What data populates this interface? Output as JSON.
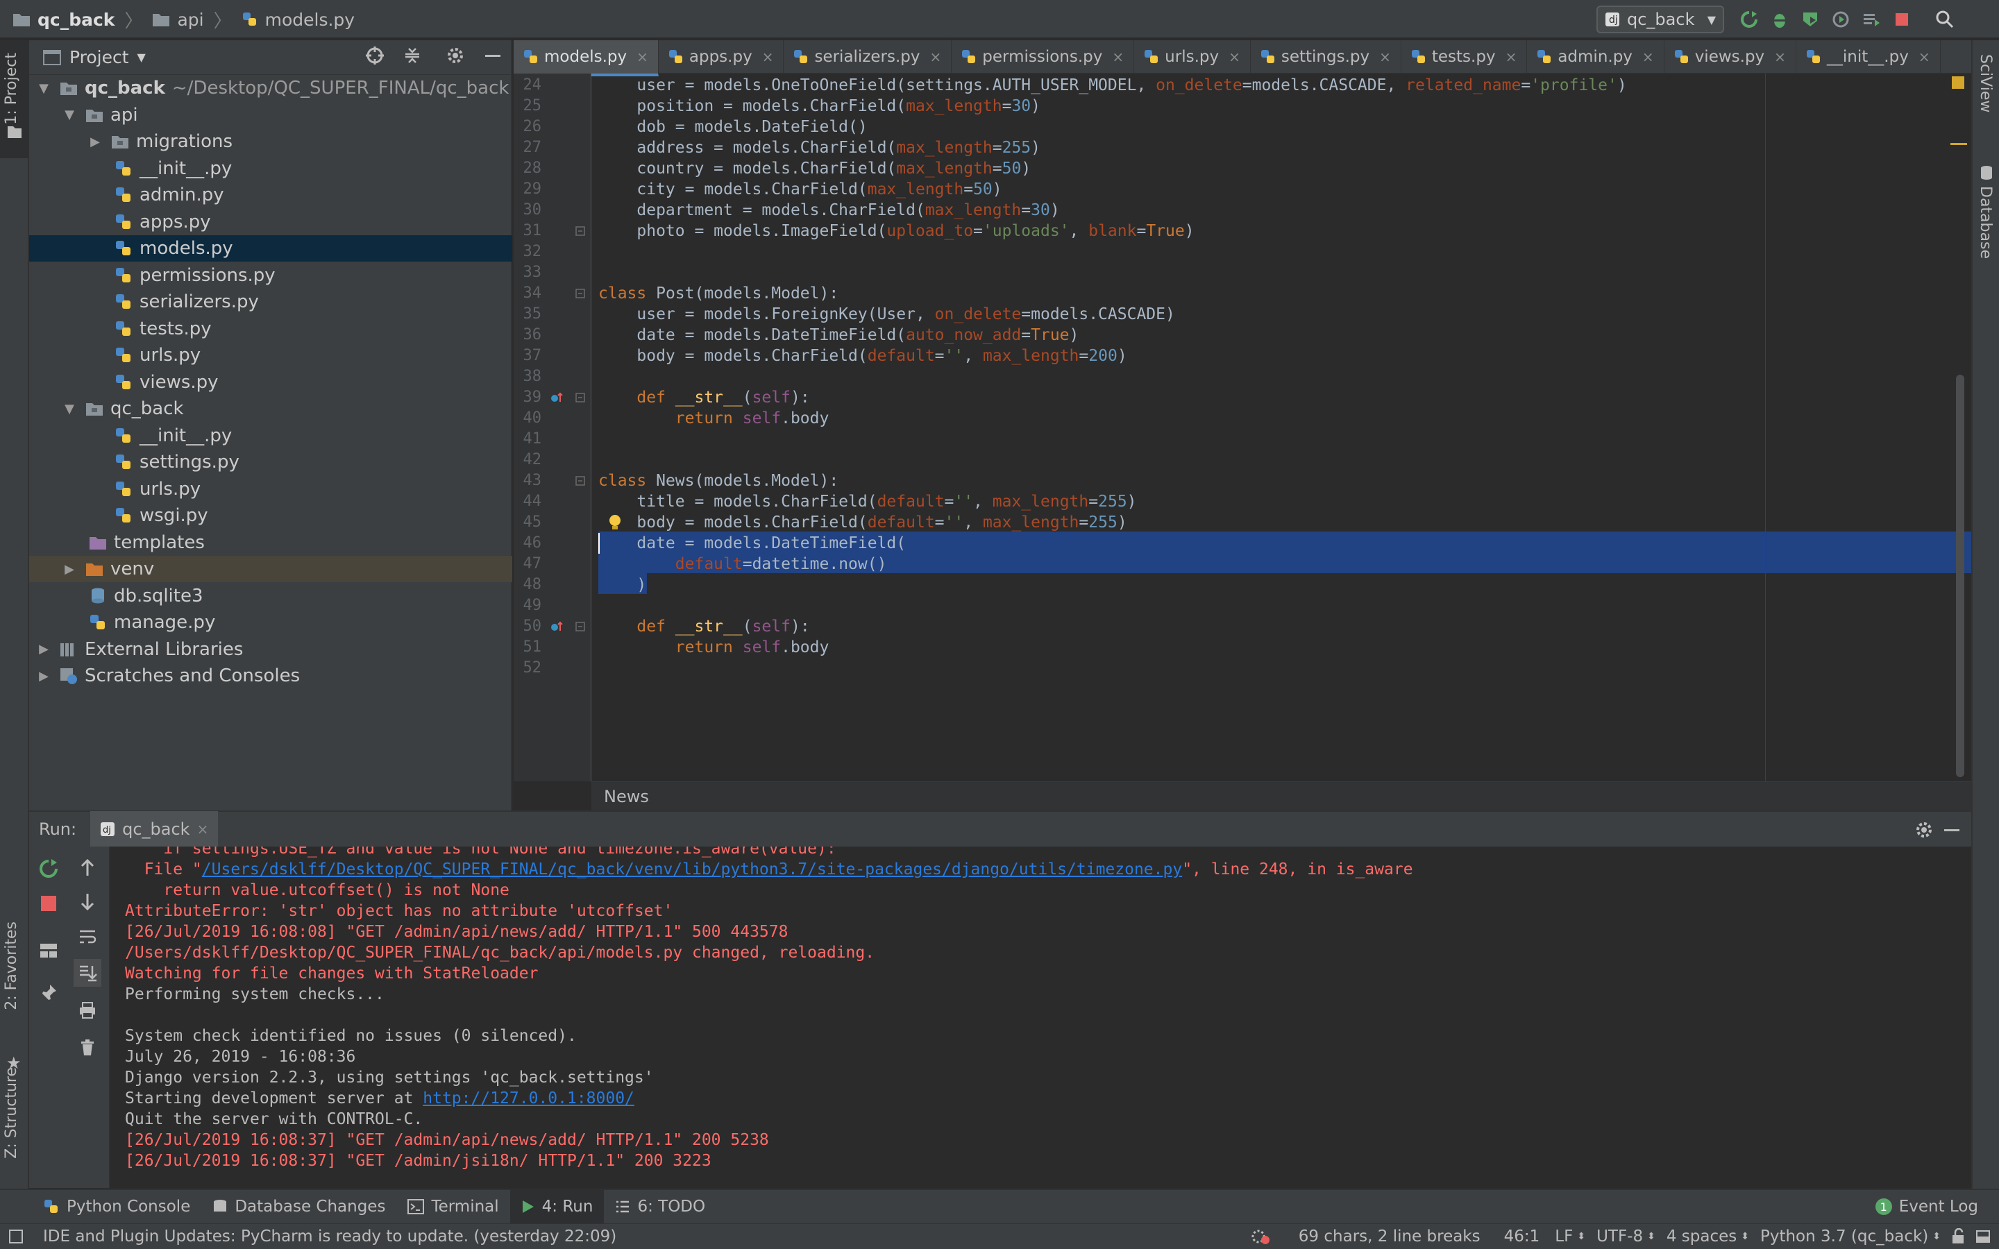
{
  "breadcrumb": [
    "qc_back",
    "api",
    "models.py"
  ],
  "run_config": {
    "name": "qc_back"
  },
  "side_labels": {
    "project": "1: Project",
    "favorites": "2: Favorites",
    "structure": "Z: Structure",
    "sciview": "SciView",
    "database": "Database"
  },
  "project_panel": {
    "title": "Project",
    "tree": [
      {
        "label": "qc_back",
        "path": "~/Desktop/QC_SUPER_FINAL/qc_back",
        "icon": "folder-icon",
        "arrow": "▼",
        "level": 0,
        "bold": true
      },
      {
        "label": "api",
        "icon": "folder-icon",
        "arrow": "▼",
        "level": 1
      },
      {
        "label": "migrations",
        "icon": "folder-icon",
        "arrow": "▶",
        "level": 2
      },
      {
        "label": "__init__.py",
        "icon": "python-file-icon",
        "level": 3
      },
      {
        "label": "admin.py",
        "icon": "python-file-icon",
        "level": 3
      },
      {
        "label": "apps.py",
        "icon": "python-file-icon",
        "level": 3
      },
      {
        "label": "models.py",
        "icon": "python-file-icon",
        "level": 3,
        "selected": true
      },
      {
        "label": "permissions.py",
        "icon": "python-file-icon",
        "level": 3
      },
      {
        "label": "serializers.py",
        "icon": "python-file-icon",
        "level": 3
      },
      {
        "label": "tests.py",
        "icon": "python-file-icon",
        "level": 3
      },
      {
        "label": "urls.py",
        "icon": "python-file-icon",
        "level": 3
      },
      {
        "label": "views.py",
        "icon": "python-file-icon",
        "level": 3
      },
      {
        "label": "qc_back",
        "icon": "folder-icon",
        "arrow": "▼",
        "level": 1
      },
      {
        "label": "__init__.py",
        "icon": "python-file-icon",
        "level": 3
      },
      {
        "label": "settings.py",
        "icon": "python-file-icon",
        "level": 3
      },
      {
        "label": "urls.py",
        "icon": "python-file-icon",
        "level": 3
      },
      {
        "label": "wsgi.py",
        "icon": "python-file-icon",
        "level": 3
      },
      {
        "label": "templates",
        "icon": "folder-purple-icon",
        "level": 2
      },
      {
        "label": "venv",
        "icon": "folder-orange-icon",
        "arrow": "▶",
        "level": 1,
        "venv": true
      },
      {
        "label": "db.sqlite3",
        "icon": "database-icon",
        "level": 2
      },
      {
        "label": "manage.py",
        "icon": "python-file-icon",
        "level": 2
      },
      {
        "label": "External Libraries",
        "icon": "library-icon",
        "arrow": "▶",
        "level": 0
      },
      {
        "label": "Scratches and Consoles",
        "icon": "scratch-icon",
        "arrow": "▶",
        "level": 0
      }
    ]
  },
  "tabs": [
    {
      "label": "models.py",
      "active": true
    },
    {
      "label": "apps.py"
    },
    {
      "label": "serializers.py"
    },
    {
      "label": "permissions.py"
    },
    {
      "label": "urls.py"
    },
    {
      "label": "settings.py"
    },
    {
      "label": "tests.py"
    },
    {
      "label": "admin.py"
    },
    {
      "label": "views.py"
    },
    {
      "label": "__init__.py"
    }
  ],
  "editor": {
    "lines": [
      {
        "n": "24",
        "code": [
          [
            "    user = models.OneToOneField(settings.AUTH_USER_MODEL, ",
            ""
          ],
          [
            "on_delete",
            "param"
          ],
          [
            "=models.CASCADE, ",
            ""
          ],
          [
            "related_name",
            "param"
          ],
          [
            "=",
            ""
          ],
          [
            "'profile'",
            "str"
          ],
          [
            ")",
            ""
          ]
        ]
      },
      {
        "n": "25",
        "code": [
          [
            "    position = models.CharField(",
            ""
          ],
          [
            "max_length",
            "param"
          ],
          [
            "=",
            ""
          ],
          [
            "30",
            "num"
          ],
          [
            ")",
            ""
          ]
        ]
      },
      {
        "n": "26",
        "code": [
          [
            "    dob = models.DateField()",
            ""
          ]
        ]
      },
      {
        "n": "27",
        "code": [
          [
            "    address = models.CharField(",
            ""
          ],
          [
            "max_length",
            "param"
          ],
          [
            "=",
            ""
          ],
          [
            "255",
            "num"
          ],
          [
            ")",
            ""
          ]
        ]
      },
      {
        "n": "28",
        "code": [
          [
            "    country = models.CharField(",
            ""
          ],
          [
            "max_length",
            "param"
          ],
          [
            "=",
            ""
          ],
          [
            "50",
            "num"
          ],
          [
            ")",
            ""
          ]
        ]
      },
      {
        "n": "29",
        "code": [
          [
            "    city = models.CharField(",
            ""
          ],
          [
            "max_length",
            "param"
          ],
          [
            "=",
            ""
          ],
          [
            "50",
            "num"
          ],
          [
            ")",
            ""
          ]
        ]
      },
      {
        "n": "30",
        "code": [
          [
            "    department = models.CharField(",
            ""
          ],
          [
            "max_length",
            "param"
          ],
          [
            "=",
            ""
          ],
          [
            "30",
            "num"
          ],
          [
            ")",
            ""
          ]
        ]
      },
      {
        "n": "31",
        "code": [
          [
            "    photo = models.ImageField(",
            ""
          ],
          [
            "upload_to",
            "param"
          ],
          [
            "=",
            ""
          ],
          [
            "'uploads'",
            "str"
          ],
          [
            ", ",
            ""
          ],
          [
            "blank",
            "param"
          ],
          [
            "=",
            ""
          ],
          [
            "True",
            "kw"
          ],
          [
            ")",
            ""
          ]
        ]
      },
      {
        "n": "32",
        "code": []
      },
      {
        "n": "33",
        "code": []
      },
      {
        "n": "34",
        "code": [
          [
            "class ",
            "kw"
          ],
          [
            "Post(models.Model):",
            ""
          ]
        ]
      },
      {
        "n": "35",
        "code": [
          [
            "    user = models.ForeignKey(User, ",
            ""
          ],
          [
            "on_delete",
            "param"
          ],
          [
            "=models.CASCADE)",
            ""
          ]
        ]
      },
      {
        "n": "36",
        "code": [
          [
            "    date = models.DateTimeField(",
            ""
          ],
          [
            "auto_now_add",
            "param"
          ],
          [
            "=",
            ""
          ],
          [
            "True",
            "kw"
          ],
          [
            ")",
            ""
          ]
        ]
      },
      {
        "n": "37",
        "code": [
          [
            "    body = models.CharField(",
            ""
          ],
          [
            "default",
            "param"
          ],
          [
            "=",
            ""
          ],
          [
            "''",
            "str"
          ],
          [
            ", ",
            ""
          ],
          [
            "max_length",
            "param"
          ],
          [
            "=",
            ""
          ],
          [
            "200",
            "num"
          ],
          [
            ")",
            ""
          ]
        ]
      },
      {
        "n": "38",
        "code": []
      },
      {
        "n": "39",
        "code": [
          [
            "    def ",
            "kw"
          ],
          [
            "__str__",
            "fn"
          ],
          [
            "(",
            ""
          ],
          [
            "self",
            "self"
          ],
          [
            "):",
            ""
          ]
        ]
      },
      {
        "n": "40",
        "code": [
          [
            "        return ",
            "kw"
          ],
          [
            "self",
            "self"
          ],
          [
            ".body",
            ""
          ]
        ]
      },
      {
        "n": "41",
        "code": []
      },
      {
        "n": "42",
        "code": []
      },
      {
        "n": "43",
        "code": [
          [
            "class ",
            "kw"
          ],
          [
            "News(models.Model):",
            ""
          ]
        ]
      },
      {
        "n": "44",
        "code": [
          [
            "    title = models.CharField(",
            ""
          ],
          [
            "default",
            "param"
          ],
          [
            "=",
            ""
          ],
          [
            "''",
            "str"
          ],
          [
            ", ",
            ""
          ],
          [
            "max_length",
            "param"
          ],
          [
            "=",
            ""
          ],
          [
            "255",
            "num"
          ],
          [
            ")",
            ""
          ]
        ]
      },
      {
        "n": "45",
        "code": [
          [
            "    body = models.CharField(",
            ""
          ],
          [
            "default",
            "param"
          ],
          [
            "=",
            ""
          ],
          [
            "''",
            "str"
          ],
          [
            ", ",
            ""
          ],
          [
            "max_length",
            "param"
          ],
          [
            "=",
            ""
          ],
          [
            "255",
            "num"
          ],
          [
            ")",
            ""
          ]
        ]
      },
      {
        "n": "46",
        "code": [
          [
            "    date = models.DateTimeField(",
            ""
          ]
        ]
      },
      {
        "n": "47",
        "code": [
          [
            "        ",
            ""
          ],
          [
            "default",
            "param"
          ],
          [
            "=datetime.now()",
            ""
          ]
        ]
      },
      {
        "n": "48",
        "code": [
          [
            "    )",
            ""
          ]
        ]
      },
      {
        "n": "49",
        "code": []
      },
      {
        "n": "50",
        "code": [
          [
            "    def ",
            "kw"
          ],
          [
            "__str__",
            "fn"
          ],
          [
            "(",
            ""
          ],
          [
            "self",
            "self"
          ],
          [
            "):",
            ""
          ]
        ]
      },
      {
        "n": "51",
        "code": [
          [
            "        return ",
            "kw"
          ],
          [
            "self",
            "self"
          ],
          [
            ".body",
            ""
          ]
        ]
      },
      {
        "n": "52",
        "code": []
      }
    ],
    "breadcrumb": "News"
  },
  "run": {
    "label": "Run:",
    "tab": "qc_back",
    "lines": [
      {
        "t": "err",
        "parts": [
          [
            "    if settings.USE_TZ and value is not None and timezone.is_aware(value):",
            ""
          ]
        ]
      },
      {
        "t": "err",
        "parts": [
          [
            "  File \"",
            ""
          ],
          [
            "/Users/dsklff/Desktop/QC_SUPER_FINAL/qc_back/venv/lib/python3.7/site-packages/django/utils/timezone.py",
            "link"
          ],
          [
            "\", line 248, in is_aware",
            ""
          ]
        ]
      },
      {
        "t": "err",
        "parts": [
          [
            "    return value.utcoffset() is not None",
            ""
          ]
        ]
      },
      {
        "t": "err",
        "parts": [
          [
            "AttributeError: 'str' object has no attribute 'utcoffset'",
            ""
          ]
        ]
      },
      {
        "t": "err",
        "parts": [
          [
            "[26/Jul/2019 16:08:08] \"GET /admin/api/news/add/ HTTP/1.1\" 500 443578",
            ""
          ]
        ]
      },
      {
        "t": "err",
        "parts": [
          [
            "/Users/dsklff/Desktop/QC_SUPER_FINAL/qc_back/api/models.py changed, reloading.",
            ""
          ]
        ]
      },
      {
        "t": "err",
        "parts": [
          [
            "Watching for file changes with StatReloader",
            ""
          ]
        ]
      },
      {
        "t": "out",
        "parts": [
          [
            "Performing system checks...",
            ""
          ]
        ]
      },
      {
        "t": "out",
        "parts": [
          [
            "",
            ""
          ]
        ]
      },
      {
        "t": "out",
        "parts": [
          [
            "System check identified no issues (0 silenced).",
            ""
          ]
        ]
      },
      {
        "t": "out",
        "parts": [
          [
            "July 26, 2019 - 16:08:36",
            ""
          ]
        ]
      },
      {
        "t": "out",
        "parts": [
          [
            "Django version 2.2.3, using settings 'qc_back.settings'",
            ""
          ]
        ]
      },
      {
        "t": "out",
        "parts": [
          [
            "Starting development server at ",
            ""
          ],
          [
            "http://127.0.0.1:8000/",
            "link"
          ]
        ]
      },
      {
        "t": "out",
        "parts": [
          [
            "Quit the server with CONTROL-C.",
            ""
          ]
        ]
      },
      {
        "t": "err",
        "parts": [
          [
            "[26/Jul/2019 16:08:37] \"GET /admin/api/news/add/ HTTP/1.1\" 200 5238",
            ""
          ]
        ]
      },
      {
        "t": "err",
        "parts": [
          [
            "[26/Jul/2019 16:08:37] \"GET /admin/jsi18n/ HTTP/1.1\" 200 3223",
            ""
          ]
        ]
      }
    ]
  },
  "toolwindows": {
    "python_console": "Python Console",
    "database_changes": "Database Changes",
    "terminal": "Terminal",
    "run": "4: Run",
    "todo": "6: TODO",
    "event_log": "Event Log",
    "event_count": "1"
  },
  "status": {
    "message": "IDE and Plugin Updates: PyCharm is ready to update. (yesterday 22:09)",
    "selection": "69 chars, 2 line breaks",
    "position": "46:1",
    "line_sep": "LF",
    "encoding": "UTF-8",
    "indent": "4 spaces",
    "interpreter": "Python 3.7 (qc_back)"
  },
  "colors": {
    "accent": "#4a88c7",
    "selection": "#214283",
    "error": "#ff6b68"
  }
}
